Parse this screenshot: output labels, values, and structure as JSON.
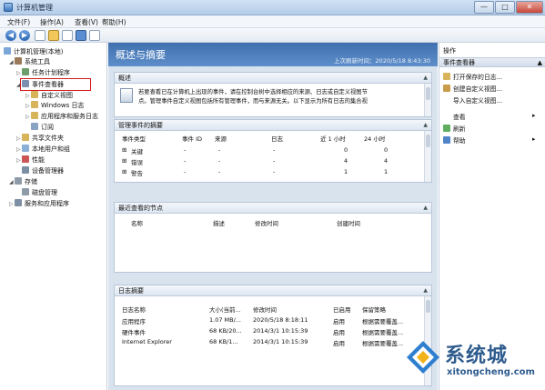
{
  "window": {
    "title": "计算机管理",
    "minimize_glyph": "—",
    "maximize_glyph": "□",
    "close_glyph": "✕"
  },
  "menu": [
    "文件(F)",
    "操作(A)",
    "查看(V)",
    "帮助(H)"
  ],
  "toolbar": {
    "back_icon": "back-arrow-icon",
    "forward_icon": "forward-arrow-icon"
  },
  "tree": {
    "root": "计算机管理(本地)",
    "system_tools": "系统工具",
    "task_scheduler": "任务计划程序",
    "event_viewer": "事件查看器",
    "custom_views": "自定义视图",
    "windows_logs": "Windows 日志",
    "app_service_logs": "应用程序和服务日志",
    "subscriptions": "订阅",
    "shared_folders": "共享文件夹",
    "local_users": "本地用户和组",
    "performance": "性能",
    "device_manager": "设备管理器",
    "storage": "存储",
    "disk_management": "磁盘管理",
    "services_apps": "服务和应用程序"
  },
  "main": {
    "header_title": "概述与摘要",
    "last_refreshed": "上次刷新时间：2020/5/18 8:43:30",
    "overview": {
      "label": "概述",
      "text_line1": "若要查看已在计算机上出现的事件，请在控制台树中选择相应的来源、日志或自定义视图节",
      "text_line2": "点。管理事件自定义视图包括所有管理事件，而与来源无关。以下显示为所有日志的集合视"
    },
    "admin_summary": {
      "label": "管理事件的摘要",
      "columns": [
        "事件类型",
        "事件 ID",
        "来源",
        "日志",
        "近 1 小时",
        "24 小时"
      ],
      "rows": [
        {
          "type": "关键",
          "id": "-",
          "source": "-",
          "log": "-",
          "h1": "0",
          "h24": "0"
        },
        {
          "type": "错误",
          "id": "-",
          "source": "-",
          "log": "-",
          "h1": "4",
          "h24": "4"
        },
        {
          "type": "警告",
          "id": "-",
          "source": "-",
          "log": "-",
          "h1": "1",
          "h24": "1"
        }
      ]
    },
    "recent_nodes": {
      "label": "最近查看的节点",
      "columns": [
        "名称",
        "描述",
        "修改时间",
        "创建时间"
      ]
    },
    "log_summary": {
      "label": "日志摘要",
      "columns": [
        "日志名称",
        "大小(当前...",
        "修改时间",
        "已启用",
        "保留策略"
      ],
      "rows": [
        {
          "name": "应用程序",
          "size": "1.07 MB/...",
          "modified": "2020/5/18 8:18:11",
          "enabled": "启用",
          "policy": "根据需要覆盖..."
        },
        {
          "name": "硬件事件",
          "size": "68 KB/20...",
          "modified": "2014/3/1 10:15:39",
          "enabled": "启用",
          "policy": "根据需要覆盖..."
        },
        {
          "name": "Internet Explorer",
          "size": "68 KB/1...",
          "modified": "2014/3/1 10:15:39",
          "enabled": "启用",
          "policy": "根据需要覆盖..."
        }
      ]
    }
  },
  "actions": {
    "header": "操作",
    "section": "事件查看器",
    "items": [
      "打开保存的日志...",
      "创建自定义视图...",
      "导入自定义视图...",
      "查看",
      "刷新",
      "帮助"
    ]
  },
  "watermark": {
    "name": "系统城",
    "url": "xitongcheng.com"
  },
  "colors": {
    "accent": "#3f6fae",
    "highlight": "#d21b1b"
  }
}
